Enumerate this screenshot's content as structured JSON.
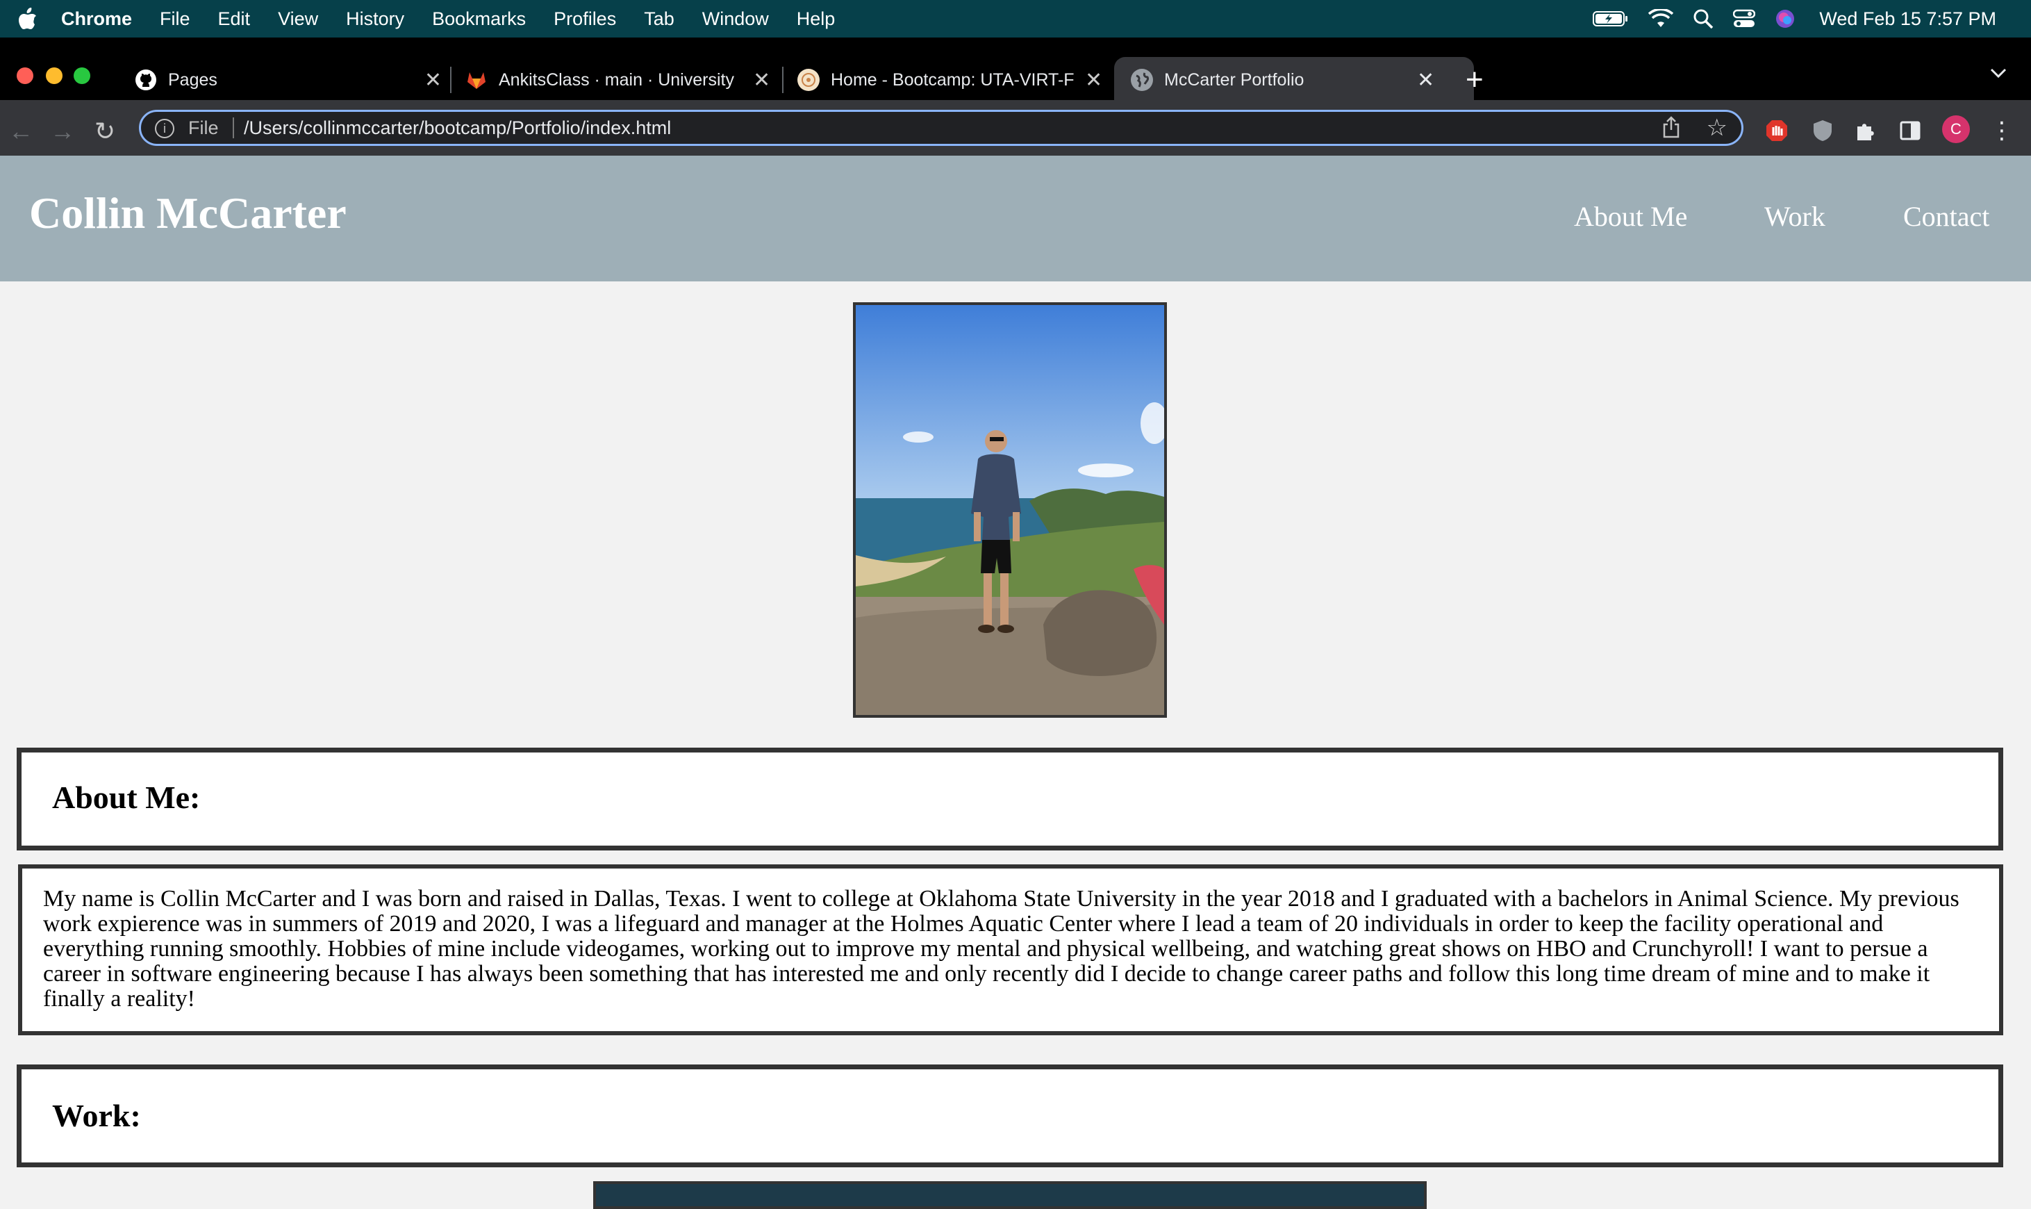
{
  "menubar": {
    "app_name": "Chrome",
    "menus": [
      "File",
      "Edit",
      "View",
      "History",
      "Bookmarks",
      "Profiles",
      "Tab",
      "Window",
      "Help"
    ],
    "clock": "Wed Feb 15  7:57 PM"
  },
  "tabs": [
    {
      "title": "Pages",
      "icon": "github-icon"
    },
    {
      "title": "AnkitsClass · main · University",
      "icon": "gitlab-icon"
    },
    {
      "title": "Home - Bootcamp: UTA-VIRT-F",
      "icon": "bootcamp-icon"
    },
    {
      "title": "McCarter Portfolio",
      "icon": "globe-icon",
      "active": true
    }
  ],
  "omnibox": {
    "scheme": "File",
    "url": "/Users/collinmccarter/bootcamp/Portfolio/index.html"
  },
  "profile_initial": "C",
  "site": {
    "title": "Collin McCarter",
    "nav": [
      "About Me",
      "Work",
      "Contact"
    ],
    "about_heading": "About Me:",
    "about_text": "My name is Collin McCarter and I was born and raised in Dallas, Texas. I went to college at Oklahoma State University in the year 2018 and I graduated with a bachelors in Animal Science. My previous work expierence was in summers of 2019 and 2020, I was a lifeguard and manager at the Holmes Aquatic Center where I lead a team of 20 individuals in order to keep the facility operational and everything running smoothly. Hobbies of mine include videogames, working out to improve my mental and physical wellbeing, and watching great shows on HBO and Crunchyroll! I want to persue a career in software engineering because I has always been something that has interested me and only recently did I decide to change career paths and follow this long time dream of mine and to make it finally a reality!",
    "work_heading": "Work:"
  },
  "colors": {
    "menubar": "#06404a",
    "header": "#9eafb7",
    "page_bg": "#f2f2f2",
    "omnibox_focus": "#8ab4f8"
  }
}
